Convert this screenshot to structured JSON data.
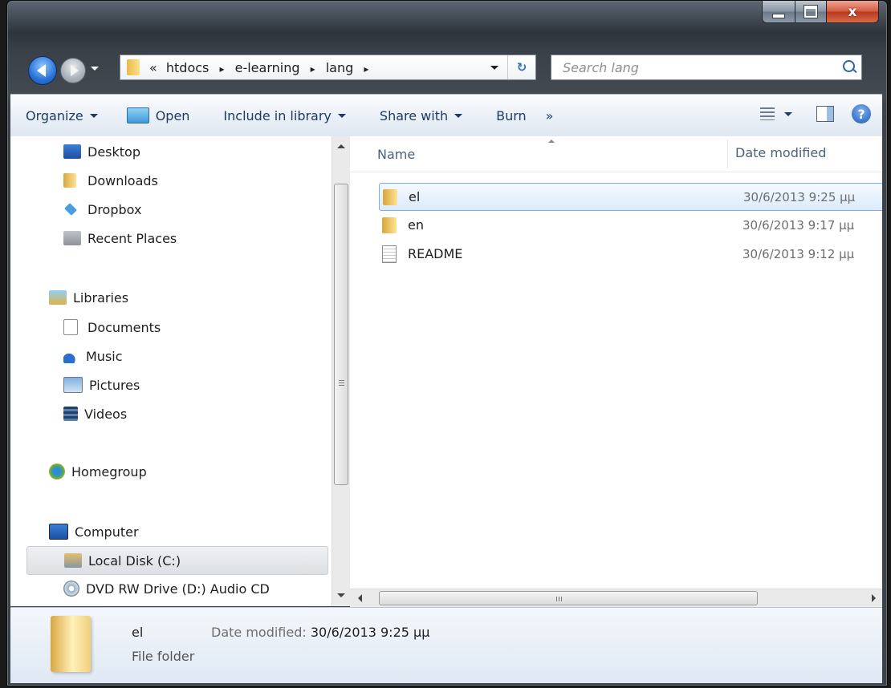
{
  "address": {
    "overflow": "«",
    "path": [
      "htdocs",
      "e-learning",
      "lang"
    ],
    "separator": "▸"
  },
  "search": {
    "placeholder": "Search lang"
  },
  "toolbar": {
    "organize": "Organize",
    "open": "Open",
    "include": "Include in library",
    "share": "Share with",
    "burn": "Burn",
    "more": "»"
  },
  "nav": {
    "favorites": [
      {
        "label": "Desktop",
        "icon": "desktop-icon"
      },
      {
        "label": "Downloads",
        "icon": "downloads-icon"
      },
      {
        "label": "Dropbox",
        "icon": "dropbox-icon"
      },
      {
        "label": "Recent Places",
        "icon": "recent-places-icon"
      }
    ],
    "libraries": "Libraries",
    "library_items": [
      {
        "label": "Documents",
        "icon": "documents-icon"
      },
      {
        "label": "Music",
        "icon": "music-icon"
      },
      {
        "label": "Pictures",
        "icon": "pictures-icon"
      },
      {
        "label": "Videos",
        "icon": "videos-icon"
      }
    ],
    "homegroup": "Homegroup",
    "computer": "Computer",
    "computer_items": [
      {
        "label": "Local Disk (C:)",
        "icon": "local-disk-icon"
      },
      {
        "label": "DVD RW Drive (D:) Audio CD",
        "icon": "dvd-drive-icon"
      }
    ]
  },
  "columns": {
    "name": "Name",
    "date": "Date modified"
  },
  "files": [
    {
      "name": "el",
      "date": "30/6/2013 9:25 μμ",
      "type": "folder"
    },
    {
      "name": "en",
      "date": "30/6/2013 9:17 μμ",
      "type": "folder"
    },
    {
      "name": "README",
      "date": "30/6/2013 9:12 μμ",
      "type": "file"
    }
  ],
  "details": {
    "name": "el",
    "type": "File folder",
    "date_label": "Date modified:",
    "date_value": "30/6/2013 9:25 μμ"
  },
  "window": {
    "close": "x"
  }
}
